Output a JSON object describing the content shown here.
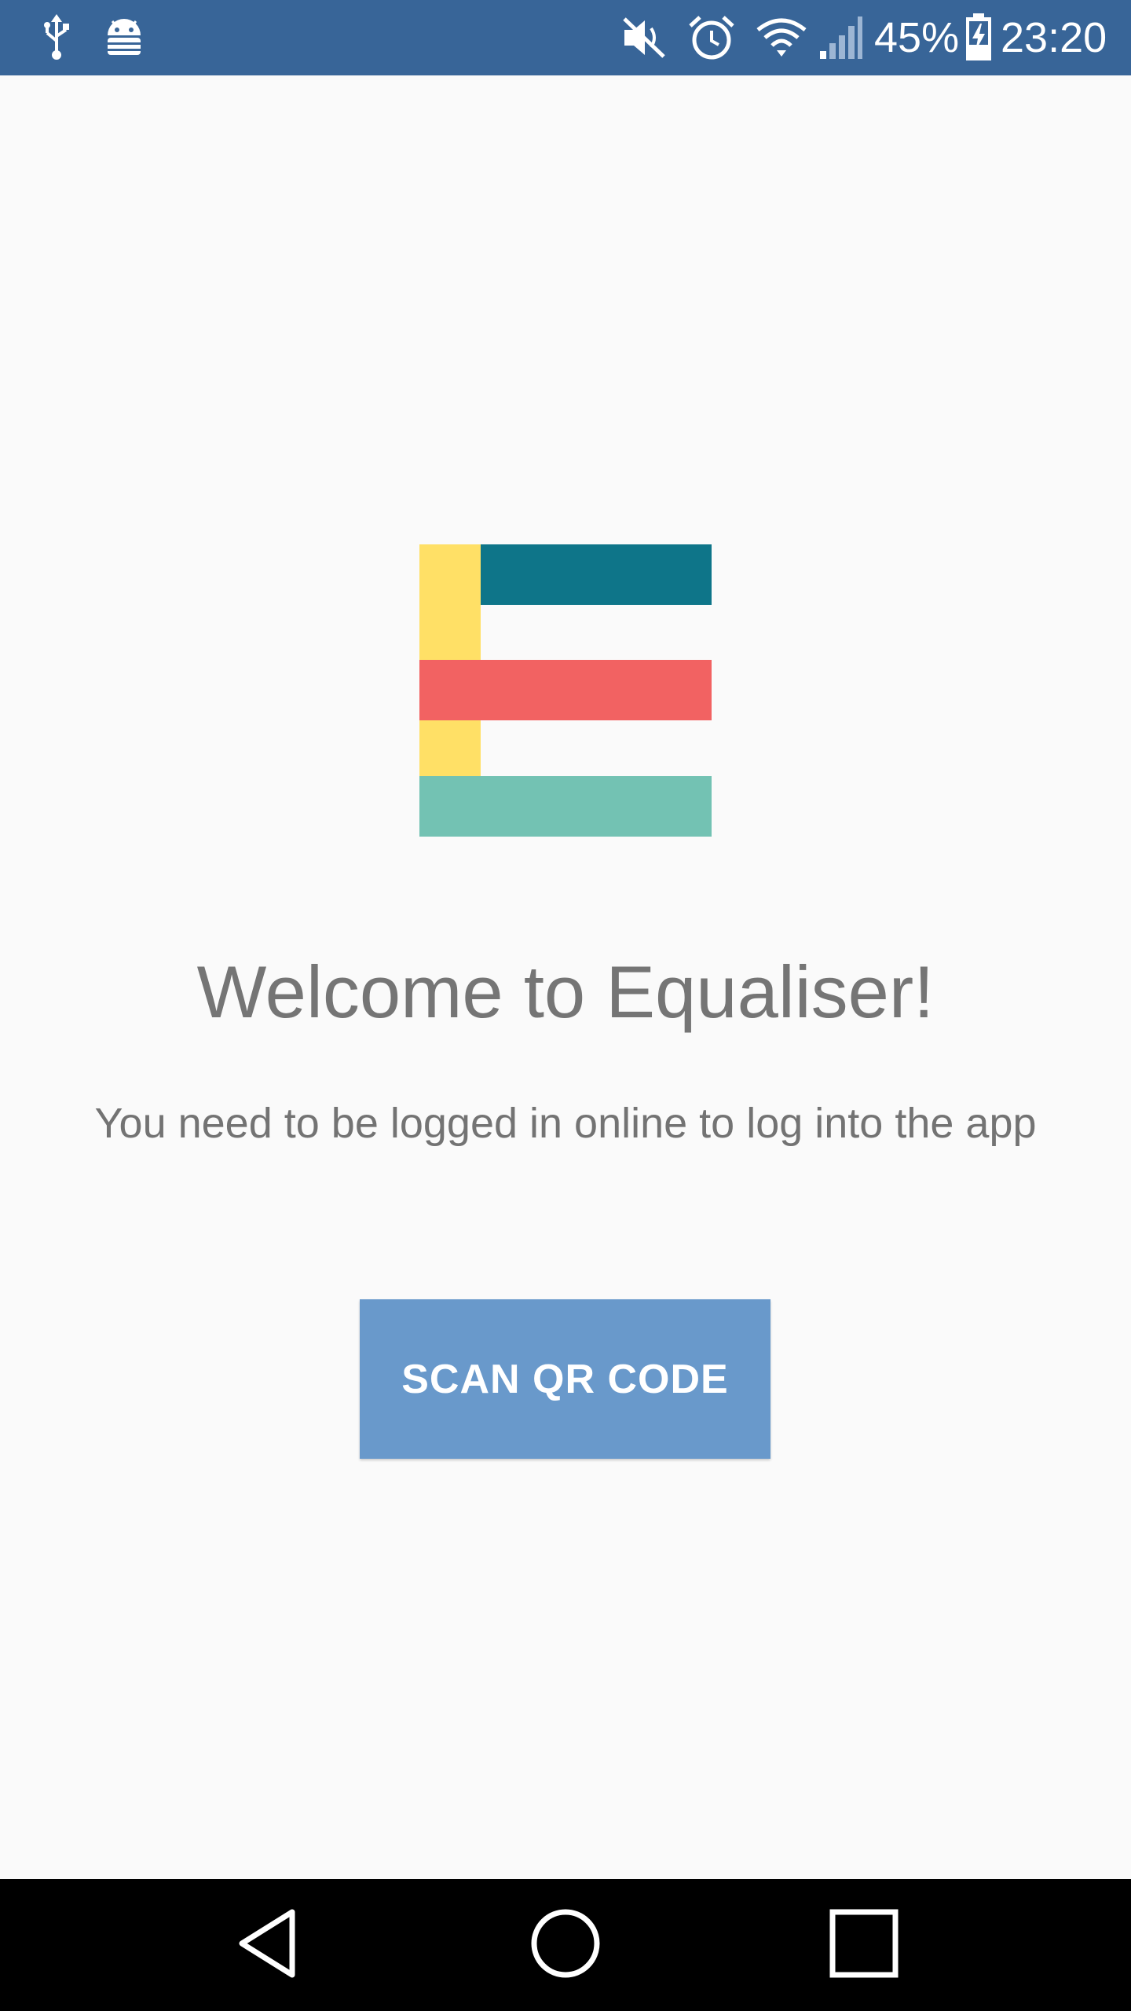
{
  "status_bar": {
    "battery_percent": "45%",
    "time": "23:20",
    "background_color": "#386598",
    "left_icons": [
      "usb-icon",
      "android-debug-icon"
    ],
    "right_icons": [
      "mute-icon",
      "alarm-icon",
      "wifi-icon",
      "signal-icon",
      "battery-charging-icon"
    ]
  },
  "logo": {
    "colors": {
      "yellow": "#ffe066",
      "teal_dark": "#0e7589",
      "red": "#f26262",
      "teal_light": "#73c2b3"
    }
  },
  "main": {
    "title": "Welcome to Equaliser!",
    "subtitle": "You need to be logged in online to log into the app",
    "scan_button_label": "SCAN QR CODE",
    "scan_button_color": "#6999cb"
  },
  "nav_bar": {
    "buttons": [
      "back-icon",
      "home-icon",
      "recents-icon"
    ]
  }
}
